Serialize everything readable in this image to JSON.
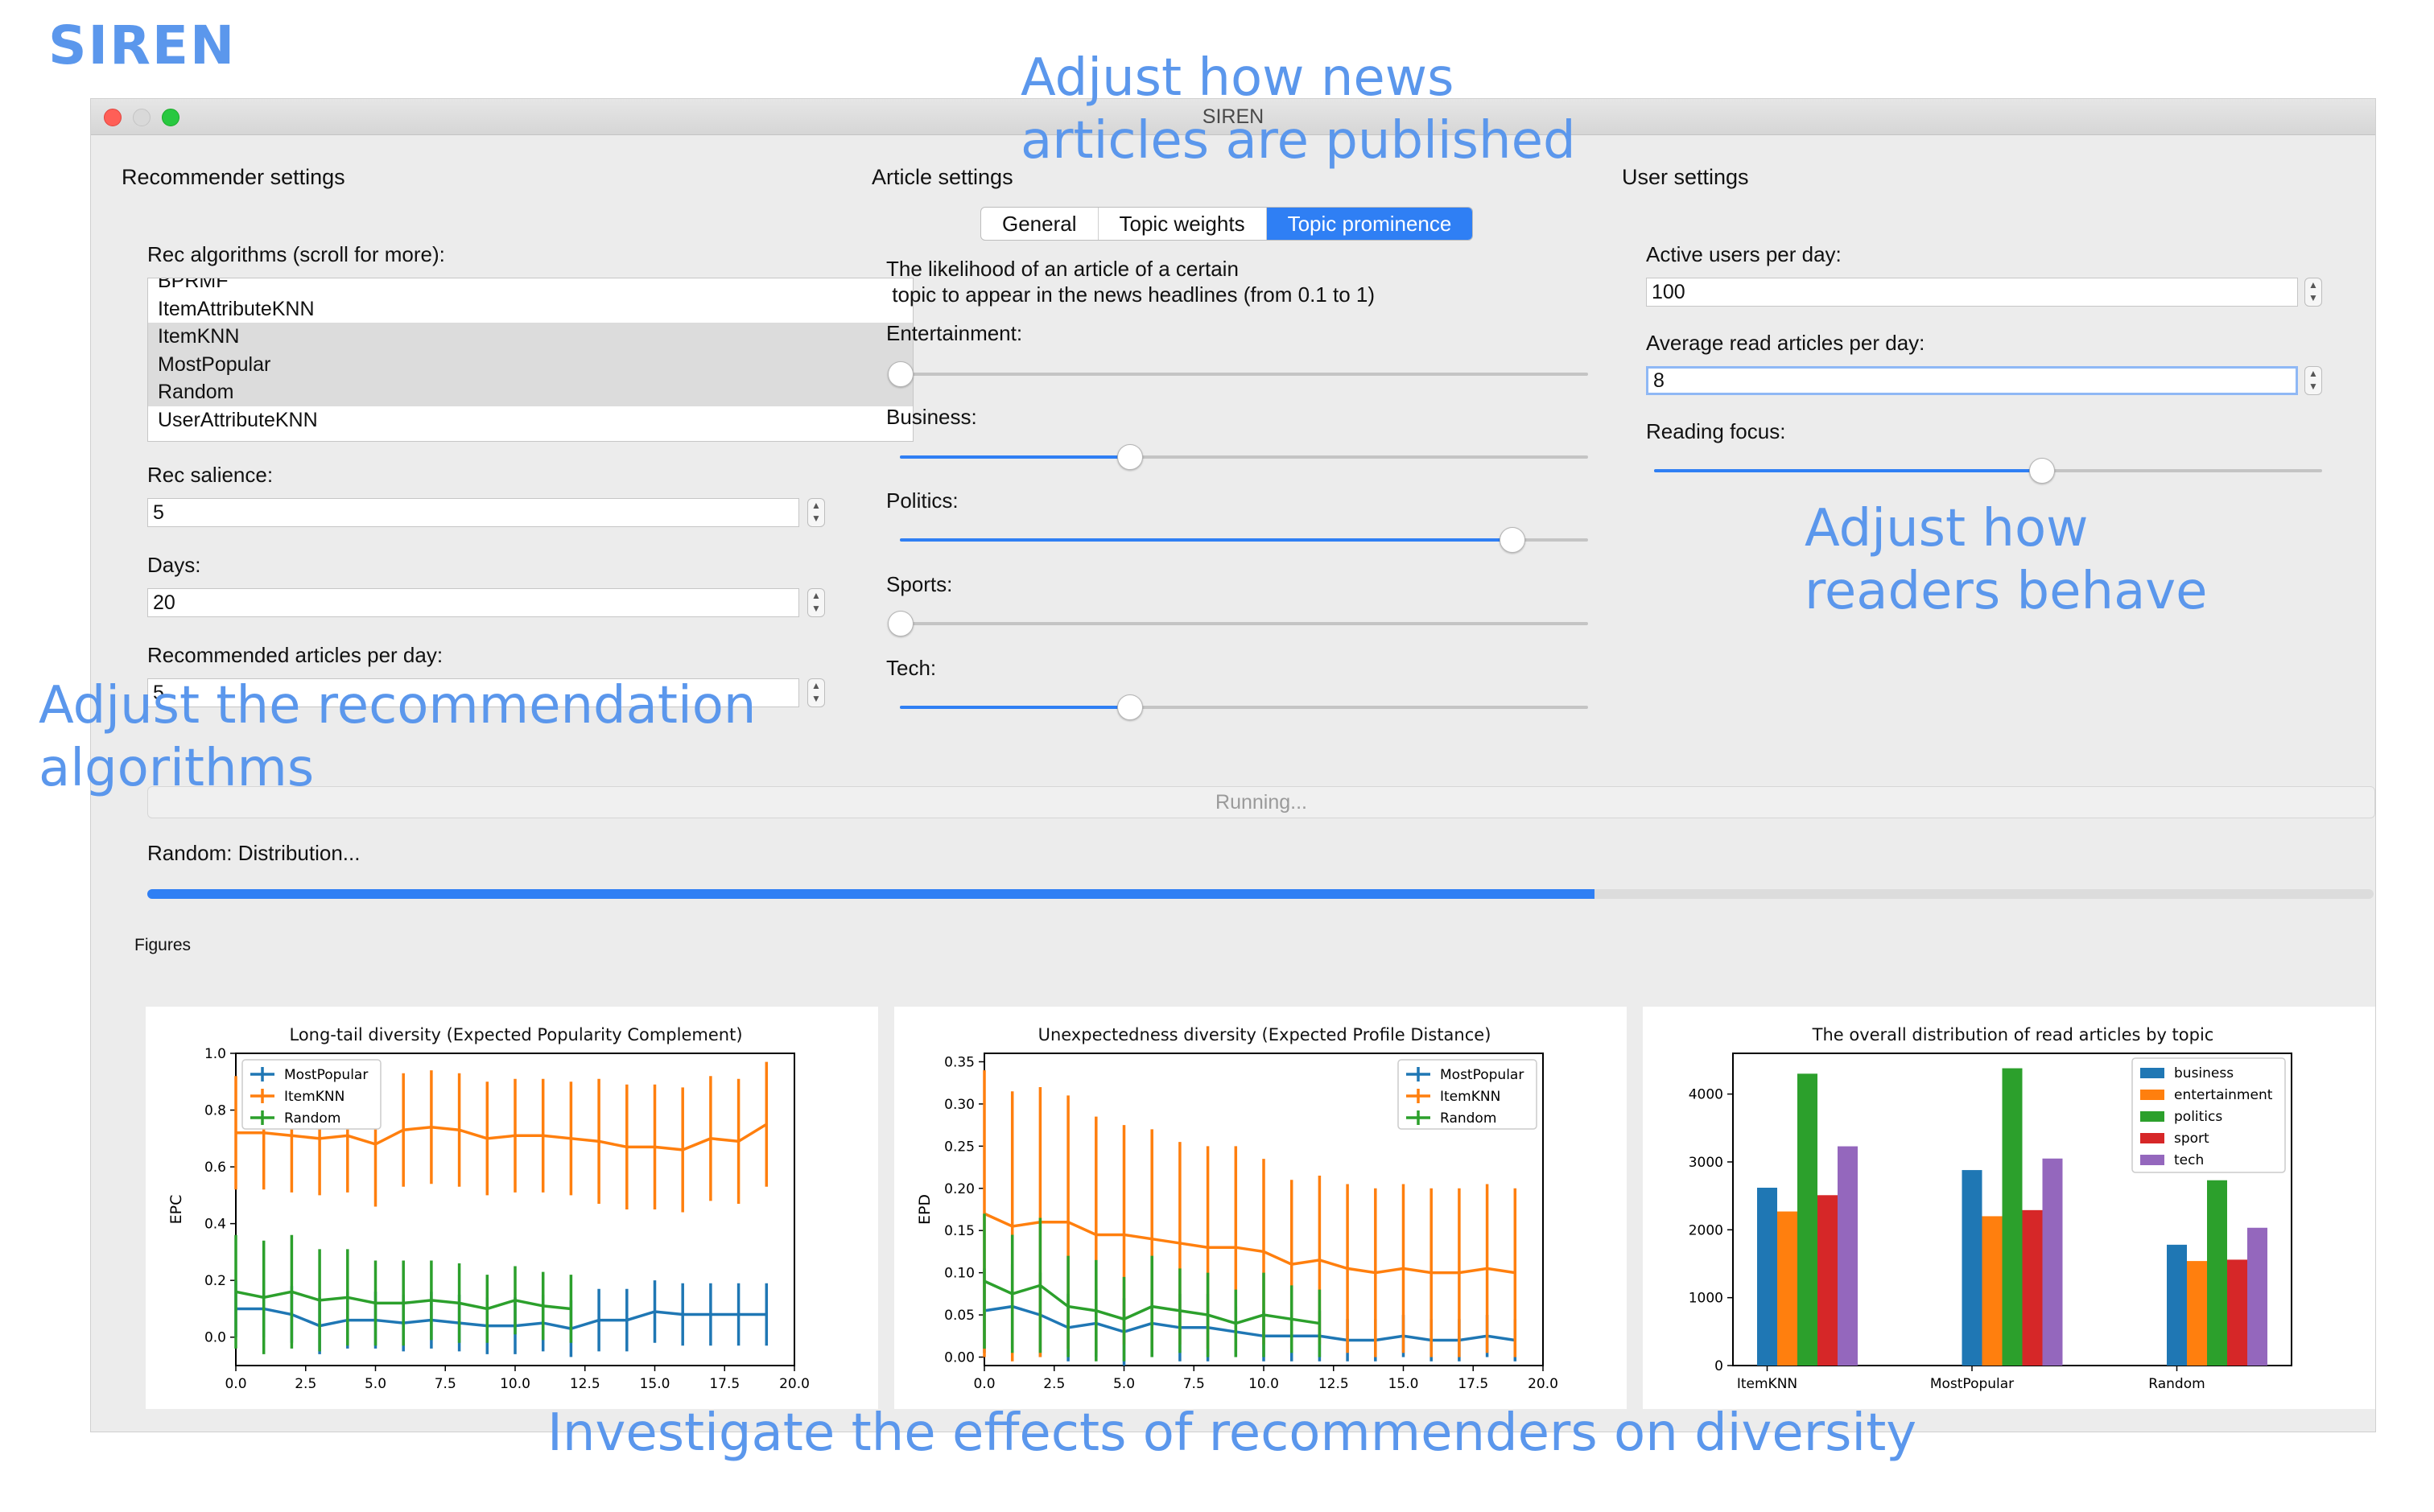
{
  "brand": "SIREN",
  "annotations": {
    "news": [
      "Adjust how news",
      "articles are published"
    ],
    "readers": [
      "Adjust how",
      "readers behave"
    ],
    "algorithms": [
      "Adjust the recommendation",
      "algorithms"
    ],
    "diversity": "Investigate the effects of recommenders on diversity"
  },
  "window": {
    "title": "SIREN"
  },
  "recommender": {
    "title": "Recommender settings",
    "algorithms_label": "Rec algorithms (scroll for more):",
    "algorithms": [
      {
        "label": "BPRMF",
        "selected": false
      },
      {
        "label": "ItemAttributeKNN",
        "selected": false
      },
      {
        "label": "ItemKNN",
        "selected": true
      },
      {
        "label": "MostPopular",
        "selected": true
      },
      {
        "label": "Random",
        "selected": true
      },
      {
        "label": "UserAttributeKNN",
        "selected": false
      }
    ],
    "salience_label": "Rec salience:",
    "salience_value": "5",
    "days_label": "Days:",
    "days_value": "20",
    "per_day_label": "Recommended articles per day:",
    "per_day_value": "5"
  },
  "article": {
    "title": "Article settings",
    "tabs": [
      "General",
      "Topic weights",
      "Topic prominence"
    ],
    "active_tab": "Topic prominence",
    "description": [
      "The likelihood of an article of a certain",
      " topic to appear in the news headlines (from 0.1 to 1)"
    ],
    "sliders": [
      {
        "label": "Entertainment:",
        "value": 0.1
      },
      {
        "label": "Business:",
        "value": 0.4
      },
      {
        "label": "Politics:",
        "value": 0.9
      },
      {
        "label": "Sports:",
        "value": 0.1
      },
      {
        "label": "Tech:",
        "value": 0.4
      }
    ]
  },
  "user": {
    "title": "User settings",
    "active_label": "Active users per day:",
    "active_value": "100",
    "avg_label": "Average read articles per day:",
    "avg_value": "8",
    "focus_label": "Reading focus:",
    "focus_value": 0.58
  },
  "status": {
    "running": "Running...",
    "message": "Random: Distribution...",
    "progress": 0.65
  },
  "figures_label": "Figures",
  "colors": {
    "MostPopular": "#1f77b4",
    "ItemKNN": "#ff7f0e",
    "Random": "#2ca02c",
    "accent": "#2f7ff4",
    "annotation": "#5b97ec"
  },
  "chart_data": [
    {
      "type": "line",
      "title": "Long-tail diversity (Expected Popularity Complement)",
      "xlabel": "",
      "ylabel": "EPC",
      "xlim": [
        0,
        20
      ],
      "ylim": [
        -0.1,
        1.0
      ],
      "xticks": [
        "0.0",
        "2.5",
        "5.0",
        "7.5",
        "10.0",
        "12.5",
        "15.0",
        "17.5",
        "20.0"
      ],
      "yticks": [
        "0.0",
        "0.2",
        "0.4",
        "0.6",
        "0.8",
        "1.0"
      ],
      "legend_position": "top-left",
      "series": [
        {
          "name": "MostPopular",
          "color": "#1f77b4",
          "x": [
            0,
            1,
            2,
            3,
            4,
            5,
            6,
            7,
            8,
            9,
            10,
            11,
            12,
            13,
            14,
            15,
            16,
            17,
            18,
            19
          ],
          "y": [
            0.1,
            0.1,
            0.08,
            0.04,
            0.06,
            0.06,
            0.05,
            0.06,
            0.05,
            0.04,
            0.04,
            0.05,
            0.03,
            0.06,
            0.06,
            0.09,
            0.08,
            0.08,
            0.08,
            0.08
          ],
          "err": [
            0.1,
            0.1,
            0.1,
            0.1,
            0.1,
            0.1,
            0.1,
            0.1,
            0.1,
            0.1,
            0.1,
            0.1,
            0.1,
            0.11,
            0.11,
            0.11,
            0.11,
            0.11,
            0.11,
            0.11
          ]
        },
        {
          "name": "ItemKNN",
          "color": "#ff7f0e",
          "x": [
            0,
            1,
            2,
            3,
            4,
            5,
            6,
            7,
            8,
            9,
            10,
            11,
            12,
            13,
            14,
            15,
            16,
            17,
            18,
            19
          ],
          "y": [
            0.72,
            0.72,
            0.71,
            0.7,
            0.71,
            0.68,
            0.73,
            0.74,
            0.73,
            0.7,
            0.71,
            0.71,
            0.7,
            0.69,
            0.67,
            0.67,
            0.66,
            0.7,
            0.69,
            0.75
          ],
          "err": [
            0.2,
            0.2,
            0.2,
            0.2,
            0.2,
            0.22,
            0.2,
            0.2,
            0.2,
            0.2,
            0.2,
            0.2,
            0.2,
            0.22,
            0.22,
            0.22,
            0.22,
            0.22,
            0.22,
            0.22
          ]
        },
        {
          "name": "Random",
          "color": "#2ca02c",
          "x": [
            0,
            1,
            2,
            3,
            4,
            5,
            6,
            7,
            8,
            9,
            10,
            11,
            12
          ],
          "y": [
            0.16,
            0.14,
            0.16,
            0.13,
            0.14,
            0.12,
            0.12,
            0.13,
            0.12,
            0.1,
            0.13,
            0.11,
            0.1
          ],
          "err": [
            0.2,
            0.2,
            0.2,
            0.18,
            0.17,
            0.15,
            0.15,
            0.14,
            0.14,
            0.12,
            0.12,
            0.12,
            0.12
          ]
        }
      ]
    },
    {
      "type": "line",
      "title": "Unexpectedness diversity (Expected Profile Distance)",
      "xlabel": "",
      "ylabel": "EPD",
      "xlim": [
        0,
        20
      ],
      "ylim": [
        -0.01,
        0.36
      ],
      "xticks": [
        "0.0",
        "2.5",
        "5.0",
        "7.5",
        "10.0",
        "12.5",
        "15.0",
        "17.5",
        "20.0"
      ],
      "yticks": [
        "0.00",
        "0.05",
        "0.10",
        "0.15",
        "0.20",
        "0.25",
        "0.30",
        "0.35"
      ],
      "legend_position": "top-right",
      "series": [
        {
          "name": "MostPopular",
          "color": "#1f77b4",
          "x": [
            0,
            1,
            2,
            3,
            4,
            5,
            6,
            7,
            8,
            9,
            10,
            11,
            12,
            13,
            14,
            15,
            16,
            17,
            18,
            19
          ],
          "y": [
            0.055,
            0.06,
            0.05,
            0.035,
            0.04,
            0.03,
            0.04,
            0.035,
            0.035,
            0.03,
            0.025,
            0.025,
            0.025,
            0.02,
            0.02,
            0.025,
            0.02,
            0.02,
            0.025,
            0.02
          ],
          "err": [
            0.05,
            0.05,
            0.05,
            0.04,
            0.04,
            0.04,
            0.04,
            0.04,
            0.04,
            0.03,
            0.03,
            0.03,
            0.03,
            0.025,
            0.025,
            0.025,
            0.025,
            0.025,
            0.025,
            0.025
          ]
        },
        {
          "name": "ItemKNN",
          "color": "#ff7f0e",
          "x": [
            0,
            1,
            2,
            3,
            4,
            5,
            6,
            7,
            8,
            9,
            10,
            11,
            12,
            13,
            14,
            15,
            16,
            17,
            18,
            19
          ],
          "y": [
            0.17,
            0.155,
            0.16,
            0.16,
            0.145,
            0.145,
            0.14,
            0.135,
            0.13,
            0.13,
            0.125,
            0.11,
            0.115,
            0.105,
            0.1,
            0.105,
            0.1,
            0.1,
            0.105,
            0.1
          ],
          "err": [
            0.17,
            0.16,
            0.16,
            0.15,
            0.14,
            0.13,
            0.13,
            0.12,
            0.12,
            0.12,
            0.11,
            0.1,
            0.1,
            0.1,
            0.1,
            0.1,
            0.1,
            0.1,
            0.1,
            0.1
          ]
        },
        {
          "name": "Random",
          "color": "#2ca02c",
          "x": [
            0,
            1,
            2,
            3,
            4,
            5,
            6,
            7,
            8,
            9,
            10,
            11,
            12
          ],
          "y": [
            0.09,
            0.075,
            0.085,
            0.06,
            0.055,
            0.045,
            0.06,
            0.055,
            0.05,
            0.04,
            0.05,
            0.045,
            0.04
          ],
          "err": [
            0.08,
            0.07,
            0.08,
            0.06,
            0.06,
            0.05,
            0.06,
            0.05,
            0.05,
            0.04,
            0.05,
            0.04,
            0.04
          ]
        }
      ]
    },
    {
      "type": "bar",
      "title": "The overall distribution of read articles by topic",
      "xlabel": "",
      "ylabel": "",
      "categories": [
        "ItemKNN",
        "MostPopular",
        "Random"
      ],
      "ylim": [
        0,
        4600
      ],
      "yticks": [
        "0",
        "1000",
        "2000",
        "3000",
        "4000"
      ],
      "legend_position": "top-right",
      "series": [
        {
          "name": "business",
          "color": "#1f77b4",
          "values": [
            2620,
            2880,
            1780
          ]
        },
        {
          "name": "entertainment",
          "color": "#ff7f0e",
          "values": [
            2270,
            2200,
            1540
          ]
        },
        {
          "name": "politics",
          "color": "#2ca02c",
          "values": [
            4300,
            4380,
            2730
          ]
        },
        {
          "name": "sport",
          "color": "#d62728",
          "values": [
            2510,
            2290,
            1560
          ]
        },
        {
          "name": "tech",
          "color": "#9467bd",
          "values": [
            3230,
            3050,
            2030
          ]
        }
      ]
    }
  ]
}
